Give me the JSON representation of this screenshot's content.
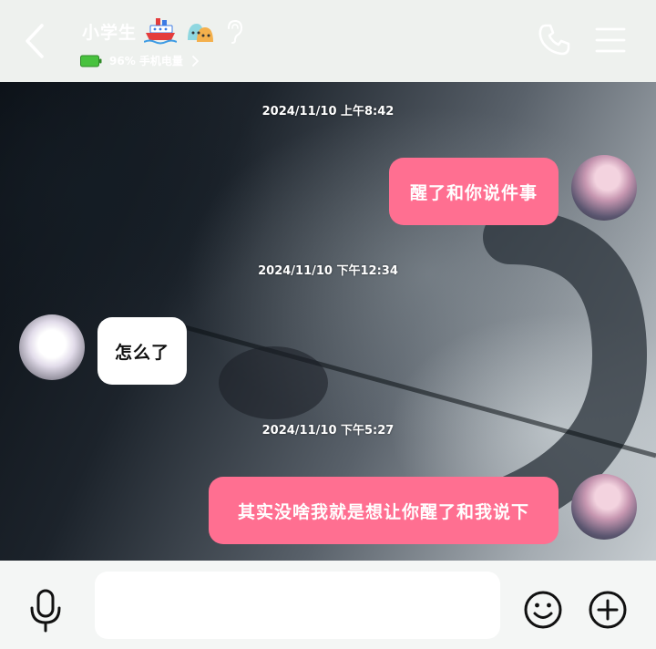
{
  "header": {
    "title": "小学生",
    "status_text": "96% 手机电量",
    "icons": [
      "back-icon",
      "ship-icon",
      "slime-icon",
      "ear-icon",
      "battery-icon",
      "chevron-right-icon",
      "phone-icon",
      "menu-icon"
    ]
  },
  "messages": [
    {
      "time": "2024/11/10 上午8:42",
      "text": "醒了和你说件事",
      "sender": "me"
    },
    {
      "time": "2024/11/10 下午12:34",
      "text": "怎么了",
      "sender": "them"
    },
    {
      "time": "2024/11/10 下午5:27",
      "text": "其实没啥我就是想让你醒了和我说下",
      "sender": "me"
    }
  ],
  "input": {
    "value": "",
    "placeholder": ""
  },
  "bottom_icons": [
    "mic-icon",
    "emoji-icon",
    "plus-icon"
  ],
  "colors": {
    "my_bubble": "#ff6f91",
    "their_bubble": "#ffffff",
    "header_bg": "#eef1ee",
    "bottom_bg": "#f4f6f5"
  }
}
